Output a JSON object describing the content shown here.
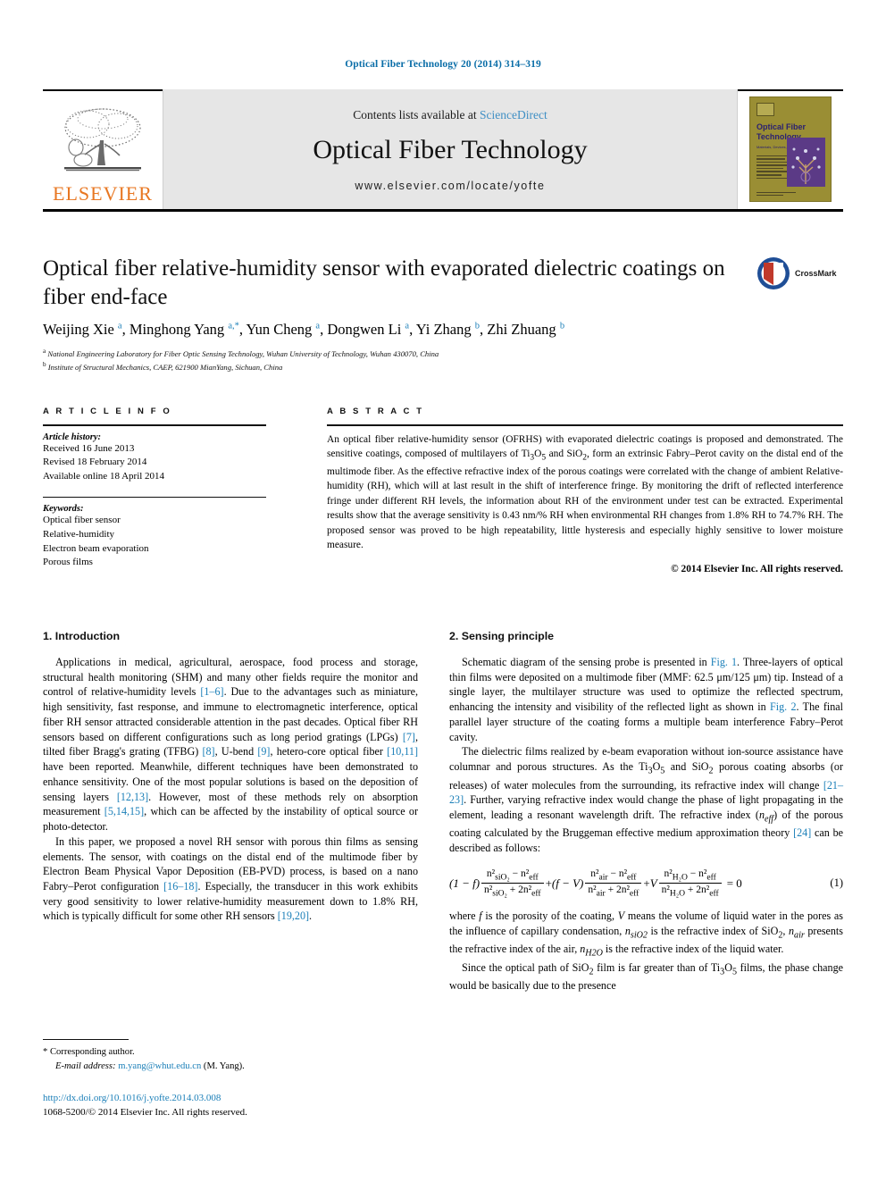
{
  "running_head": "Optical Fiber Technology 20 (2014) 314–319",
  "banner": {
    "contents_prefix": "Contents lists available at ",
    "sciencedirect": "ScienceDirect",
    "journal_name": "Optical Fiber Technology",
    "url": "www.elsevier.com/locate/yofte",
    "publisher_logo_text": "ELSEVIER",
    "cover": {
      "line1": "Optical  Fiber",
      "line2": "Technology",
      "subtitle": "Materials, Devices, and Systems"
    }
  },
  "crossmark": {
    "label": "CrossMark"
  },
  "article": {
    "title": "Optical fiber relative-humidity sensor with evaporated dielectric coatings on fiber end-face",
    "authors_html": "Weijing Xie <sup>a</sup>, Minghong Yang <sup>a,</sup><sup>*</sup>, Yun Cheng <sup>a</sup>, Dongwen Li <sup>a</sup>, Yi Zhang <sup>b</sup>, Zhi Zhuang <sup>b</sup>",
    "affiliation_a": "National Engineering Laboratory for Fiber Optic Sensing Technology, Wuhan University of Technology, Wuhan 430070, China",
    "affiliation_b": "Institute of Structural Mechanics, CAEP, 621900 MianYang, Sichuan, China"
  },
  "article_info": {
    "heading": "A R T I C L E   I N F O",
    "history_title": "Article history:",
    "history": [
      "Received 16 June 2013",
      "Revised 18 February 2014",
      "Available online 18 April 2014"
    ],
    "keywords_title": "Keywords:",
    "keywords": [
      "Optical fiber sensor",
      "Relative-humidity",
      "Electron beam evaporation",
      "Porous films"
    ]
  },
  "abstract": {
    "heading": "A B S T R A C T",
    "text_html": "An optical fiber relative-humidity sensor (OFRHS) with evaporated dielectric coatings is proposed and demonstrated. The sensitive coatings, composed of multilayers of Ti<sub>3</sub>O<sub>5</sub> and SiO<sub>2</sub>, form an extrinsic Fabry–Perot cavity on the distal end of the multimode fiber. As the effective refractive index of the porous coatings were correlated with the change of ambient Relative-humidity (RH), which will at last result in the shift of interference fringe. By monitoring the drift of reflected interference fringe under different RH levels, the information about RH of the environment under test can be extracted. Experimental results show that the average sensitivity is 0.43 nm/% RH when environmental RH changes from 1.8% RH to 74.7% RH. The proposed sensor was proved to be high repeatability, little hysteresis and especially highly sensitive to lower moisture measure.",
    "copyright": "© 2014 Elsevier Inc. All rights reserved."
  },
  "sections": {
    "intro": {
      "heading": "1. Introduction",
      "p1_html": "Applications in medical, agricultural, aerospace, food process and storage, structural health monitoring (SHM) and many other fields require the monitor and control of relative-humidity levels <span class=\"cite\">[1–6]</span>. Due to the advantages such as miniature, high sensitivity, fast response, and immune to electromagnetic interference, optical fiber RH sensor attracted considerable attention in the past decades. Optical fiber RH sensors based on different configurations such as long period gratings (LPGs) <span class=\"cite\">[7]</span>, tilted fiber Bragg's grating (TFBG) <span class=\"cite\">[8]</span>, U-bend <span class=\"cite\">[9]</span>, hetero-core optical fiber <span class=\"cite\">[10,11]</span> have been reported. Meanwhile, different techniques have been demonstrated to enhance sensitivity. One of the most popular solutions is based on the deposition of sensing layers <span class=\"cite\">[12,13]</span>. However, most of these methods rely on absorption measurement <span class=\"cite\">[5,14,15]</span>, which can be affected by the instability of optical source or photo-detector.",
      "p2_html": "In this paper, we proposed a novel RH sensor with porous thin films as sensing elements. The sensor, with coatings on the distal end of the multimode fiber by Electron Beam Physical Vapor Deposition (EB-PVD) process, is based on a nano Fabry–Perot configuration <span class=\"cite\">[16–18]</span>. Especially, the transducer in this work exhibits very good sensitivity to lower relative-humidity measurement down to 1.8% RH, which is typically difficult for some other RH sensors <span class=\"cite\">[19,20]</span>."
    },
    "sensing": {
      "heading": "2. Sensing principle",
      "p1_html": "Schematic diagram of the sensing probe is presented in <span class=\"cite\">Fig. 1</span>. Three-layers of optical thin films were deposited on a multimode fiber (MMF: 62.5 μm/125 μm) tip. Instead of a single layer, the multilayer structure was used to optimize the reflected spectrum, enhancing the intensity and visibility of the reflected light as shown in <span class=\"cite\">Fig. 2</span>. The final parallel layer structure of the coating forms a multiple beam interference Fabry–Perot cavity.",
      "p2_html": "The dielectric films realized by e-beam evaporation without ion-source assistance have columnar and porous structures. As the Ti<sub>3</sub>O<sub>5</sub> and SiO<sub>2</sub> porous coating absorbs (or releases) of water molecules from the surrounding, its refractive index will change <span class=\"cite\">[21–23]</span>. Further, varying refractive index would change the phase of light propagating in the element, leading a resonant wavelength drift. The refractive index (<i>n<sub>eff</sub></i>) of the porous coating calculated by the Bruggeman effective medium approximation theory <span class=\"cite\">[24]</span> can be described as follows:",
      "p3_html": "where <i>f</i> is the porosity of the coating, <i>V</i> means the volume of liquid water in the pores as the influence of capillary condensation, <i>n<sub>siO2</sub></i> is the refractive index of SiO<sub>2</sub>, <i>n<sub>air</sub></i> presents the refractive index of the air, <i>n<sub>H2O</sub></i> is the refractive index of the liquid water.",
      "p4_html": "Since the optical path of SiO<sub>2</sub> film is far greater than of Ti<sub>3</sub>O<sub>5</sub> films, the phase change would be basically due to the presence"
    }
  },
  "equation": {
    "number": "(1)",
    "term1_lead": "(1 − f)",
    "t1_num": "n²<sub>siO₂</sub> − n²<sub>eff</sub>",
    "t1_den": "n²<sub>siO₂</sub> + 2n²<sub>eff</sub>",
    "op1": "+",
    "term2_lead": "(f − V)",
    "t2_num": "n²<sub>air</sub> − n²<sub>eff</sub>",
    "t2_den": "n²<sub>air</sub> + 2n²<sub>eff</sub>",
    "op2": "+",
    "term3_lead": "V",
    "t3_num": "n²<sub>H₂O</sub> − n²<sub>eff</sub>",
    "t3_den": "n²<sub>H₂O</sub> + 2n²<sub>eff</sub>",
    "equals": "= 0"
  },
  "footnote": {
    "corresponding": "* Corresponding author.",
    "email_label": "E-mail address:",
    "email": "m.yang@whut.edu.cn",
    "email_suffix": "(M. Yang)."
  },
  "footer": {
    "doi": "http://dx.doi.org/10.1016/j.yofte.2014.03.008",
    "issn": "1068-5200/© 2014 Elsevier Inc. All rights reserved."
  },
  "colors": {
    "link": "#1b7fb8",
    "elsevier_orange": "#e87722",
    "banner_grey": "#e6e6e6",
    "cover_gold": "#9a8e34"
  }
}
